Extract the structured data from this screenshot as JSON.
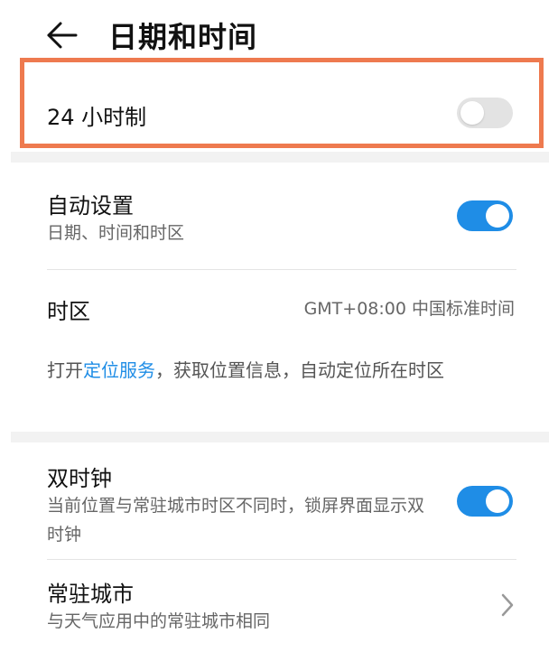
{
  "header": {
    "title": "日期和时间",
    "back_icon": "arrow-left-icon"
  },
  "highlight_color": "#ee7a4f",
  "accent_color": "#1f8de6",
  "settings": {
    "hour24": {
      "label": "24 小时制",
      "enabled": false
    },
    "auto_set": {
      "label": "自动设置",
      "subtitle": "日期、时间和时区",
      "enabled": true
    },
    "timezone": {
      "label": "时区",
      "value": "GMT+08:00 中国标准时间"
    },
    "location_hint": {
      "prefix": "打开",
      "link": "定位服务",
      "suffix": "，获取位置信息，自动定位所在时区"
    },
    "dual_clock": {
      "label": "双时钟",
      "subtitle": "当前位置与常驻城市时区不同时，锁屏界面显示双时钟",
      "enabled": true
    },
    "home_city": {
      "label": "常驻城市",
      "subtitle": "与天气应用中的常驻城市相同",
      "chevron_icon": "chevron-right-icon"
    }
  }
}
